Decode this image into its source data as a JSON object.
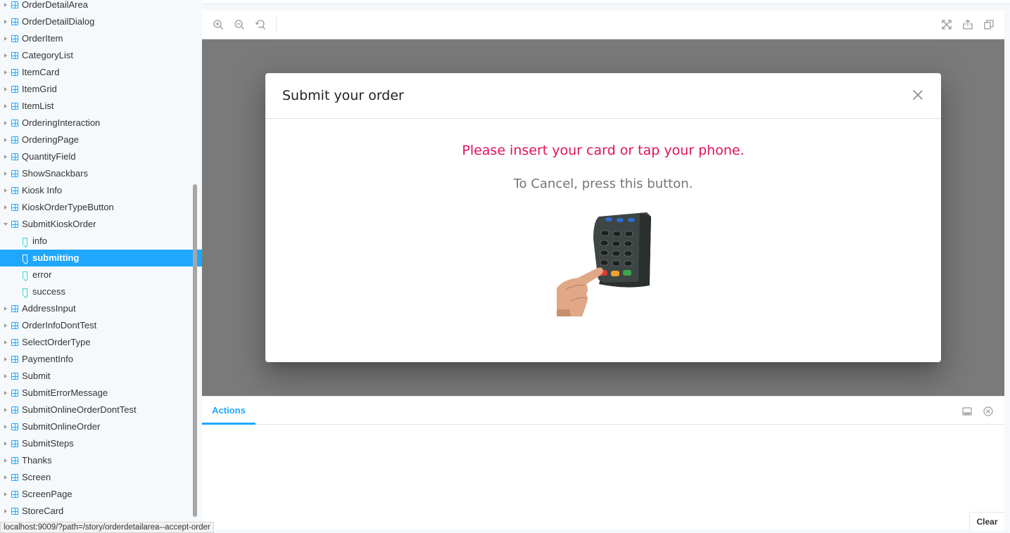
{
  "sidebar": {
    "items": [
      {
        "label": "OrderDetailArea",
        "kind": "component"
      },
      {
        "label": "OrderDetailDialog",
        "kind": "component"
      },
      {
        "label": "OrderItem",
        "kind": "component"
      },
      {
        "label": "CategoryList",
        "kind": "component"
      },
      {
        "label": "ItemCard",
        "kind": "component"
      },
      {
        "label": "ItemGrid",
        "kind": "component"
      },
      {
        "label": "ItemList",
        "kind": "component"
      },
      {
        "label": "OrderingInteraction",
        "kind": "component"
      },
      {
        "label": "OrderingPage",
        "kind": "component"
      },
      {
        "label": "QuantityField",
        "kind": "component"
      },
      {
        "label": "ShowSnackbars",
        "kind": "component"
      },
      {
        "label": "Kiosk Info",
        "kind": "component"
      },
      {
        "label": "KioskOrderTypeButton",
        "kind": "component"
      },
      {
        "label": "SubmitKioskOrder",
        "kind": "component-open"
      },
      {
        "label": "info",
        "kind": "story"
      },
      {
        "label": "submitting",
        "kind": "story-selected"
      },
      {
        "label": "error",
        "kind": "story"
      },
      {
        "label": "success",
        "kind": "story"
      },
      {
        "label": "AddressInput",
        "kind": "component"
      },
      {
        "label": "OrderInfoDontTest",
        "kind": "component"
      },
      {
        "label": "SelectOrderType",
        "kind": "component"
      },
      {
        "label": "PaymentInfo",
        "kind": "component"
      },
      {
        "label": "Submit",
        "kind": "component"
      },
      {
        "label": "SubmitErrorMessage",
        "kind": "component"
      },
      {
        "label": "SubmitOnlineOrderDontTest",
        "kind": "component"
      },
      {
        "label": "SubmitOnlineOrder",
        "kind": "component"
      },
      {
        "label": "SubmitSteps",
        "kind": "component"
      },
      {
        "label": "Thanks",
        "kind": "component"
      },
      {
        "label": "Screen",
        "kind": "component"
      },
      {
        "label": "ScreenPage",
        "kind": "component"
      },
      {
        "label": "StoreCard",
        "kind": "component"
      }
    ]
  },
  "status_bar": {
    "url": "localhost:9009/?path=/story/orderdetailarea--accept-order"
  },
  "toolbar": {
    "left_icons": [
      "zoom-in-icon",
      "zoom-out-icon",
      "zoom-reset-icon"
    ],
    "right_icons": [
      "fullscreen-icon",
      "share-icon",
      "copy-icon"
    ]
  },
  "dialog": {
    "title": "Submit your order",
    "message": "Please insert your card or tap your phone.",
    "cancel_text": "To Cancel, press this button.",
    "image": "card-terminal-image",
    "message_color": "#e0115f"
  },
  "addons": {
    "tab_label": "Actions",
    "clear_label": "Clear",
    "icons": [
      "panel-position-icon",
      "close-panel-icon"
    ]
  },
  "colors": {
    "accent": "#1ea7fd",
    "backdrop": "#7a7a7a"
  }
}
